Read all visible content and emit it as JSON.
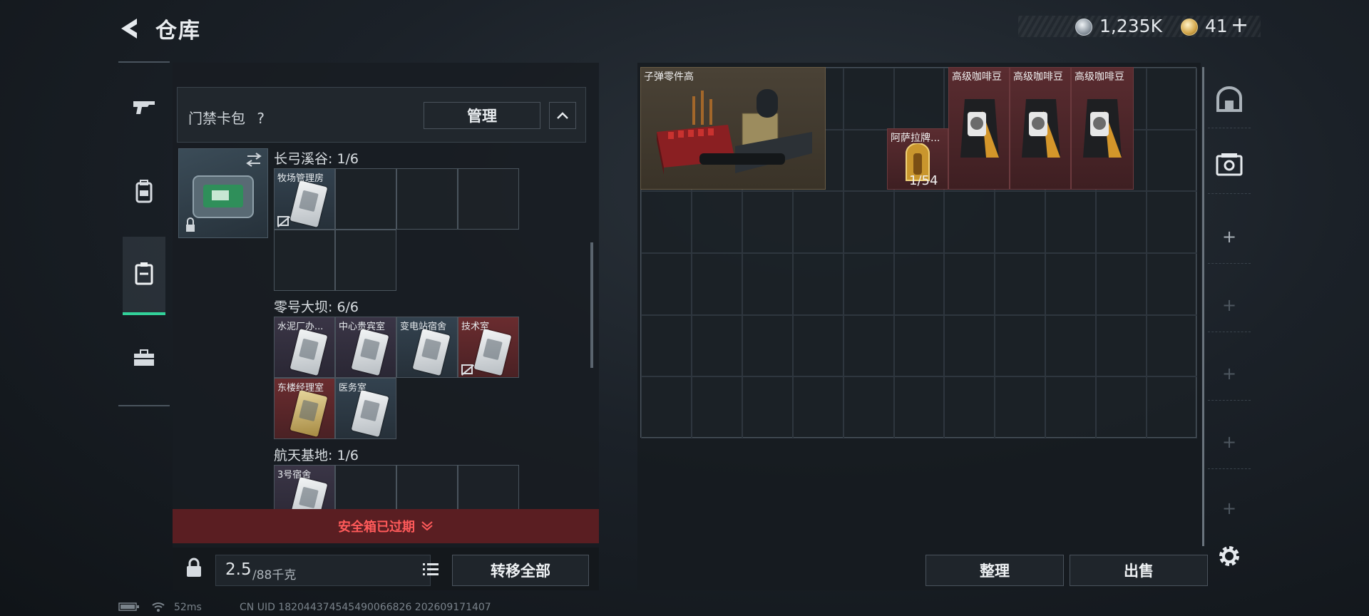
{
  "header": {
    "title": "仓库",
    "currency_silver": "1,235K",
    "currency_gold": "41",
    "add_label": "+"
  },
  "nav": {
    "items": [
      {
        "name": "weapon",
        "icon": "gun-icon"
      },
      {
        "name": "equipment",
        "icon": "backpack-icon"
      },
      {
        "name": "keycard",
        "icon": "keycard-case-icon",
        "active": true
      },
      {
        "name": "toolbox",
        "icon": "briefcase-icon"
      }
    ]
  },
  "keycase": {
    "title": "门禁卡包",
    "help": "?",
    "manage_label": "管理"
  },
  "sections": [
    {
      "title": "长弓溪谷: 1/6",
      "slots": [
        {
          "label": "牧场管理房",
          "color": "blue",
          "expired": true
        }
      ]
    },
    {
      "title": "零号大坝: 6/6",
      "slots": [
        {
          "label": "水泥厂办...",
          "color": "purple"
        },
        {
          "label": "中心贵宾室",
          "color": "purple"
        },
        {
          "label": "变电站宿舍",
          "color": "blue"
        },
        {
          "label": "技术室",
          "color": "red",
          "expired": true
        },
        {
          "label": "东楼经理室",
          "color": "red",
          "gold": true
        },
        {
          "label": "医务室",
          "color": "blue"
        }
      ]
    },
    {
      "title": "航天基地: 1/6",
      "slots": [
        {
          "label": "3号宿舍",
          "color": "purple"
        }
      ]
    }
  ],
  "warning": "安全箱已过期",
  "bottom": {
    "weight_value": "2.5",
    "weight_max": "/88千克",
    "transfer_label": "转移全部"
  },
  "stash": {
    "items": [
      {
        "label": "子弹零件高",
        "kind": "ammo-crate"
      },
      {
        "label": "阿萨拉牌...",
        "count": "1/54",
        "kind": "token"
      },
      {
        "label": "高级咖啡豆",
        "kind": "coffee"
      },
      {
        "label": "高级咖啡豆",
        "kind": "coffee"
      },
      {
        "label": "高级咖啡豆",
        "kind": "coffee"
      }
    ],
    "sort_label": "整理",
    "sell_label": "出售"
  },
  "status": {
    "ping": "52ms",
    "uid": "CN UID 182044374545490066826 202609171407"
  },
  "colors": {
    "accent": "#32d29a",
    "warning": "#ff5a5a",
    "gold_slot": "#6a2c2f"
  }
}
